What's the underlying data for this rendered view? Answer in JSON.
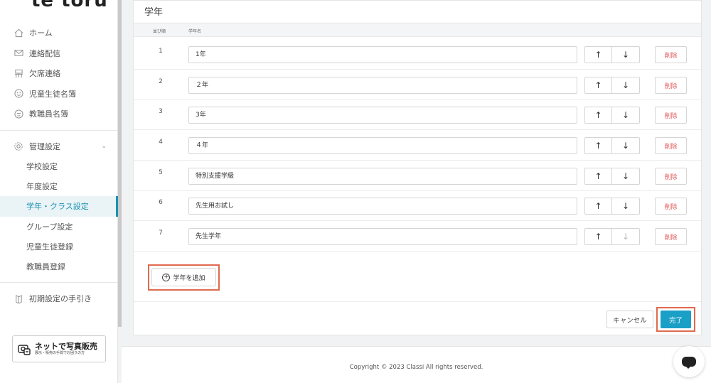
{
  "sidebar": {
    "logo": "te toru",
    "nav": [
      {
        "label": "ホーム",
        "icon": "home-icon"
      },
      {
        "label": "連絡配信",
        "icon": "mail-icon"
      },
      {
        "label": "欠席連絡",
        "icon": "desk-icon"
      },
      {
        "label": "児童生徒名簿",
        "icon": "student-icon"
      },
      {
        "label": "教職員名簿",
        "icon": "teacher-icon"
      }
    ],
    "admin": {
      "label": "管理設定",
      "icon": "gear-icon"
    },
    "sub": [
      {
        "label": "学校設定",
        "active": false
      },
      {
        "label": "年度設定",
        "active": false
      },
      {
        "label": "学年・クラス設定",
        "active": true
      },
      {
        "label": "グループ設定",
        "active": false
      },
      {
        "label": "児童生徒登録",
        "active": false
      },
      {
        "label": "教職員登録",
        "active": false
      }
    ],
    "guide": {
      "label": "初期設定の手引き",
      "icon": "book-icon"
    },
    "banner": {
      "title": "ネットで写真販売",
      "subtitle": "展示・販売の手間でお困りの方"
    }
  },
  "card": {
    "title": "学年",
    "headers": {
      "order": "並び順",
      "name": "学年名"
    },
    "rows": [
      {
        "order": "1",
        "name": "1年",
        "up_disabled": false,
        "down_disabled": false
      },
      {
        "order": "2",
        "name": "２年",
        "up_disabled": false,
        "down_disabled": false
      },
      {
        "order": "3",
        "name": "3年",
        "up_disabled": false,
        "down_disabled": false
      },
      {
        "order": "4",
        "name": "４年",
        "up_disabled": false,
        "down_disabled": false
      },
      {
        "order": "5",
        "name": "特別支援学級",
        "up_disabled": false,
        "down_disabled": false
      },
      {
        "order": "6",
        "name": "先生用お試し",
        "up_disabled": false,
        "down_disabled": false
      },
      {
        "order": "7",
        "name": "先生学年",
        "up_disabled": false,
        "down_disabled": true
      }
    ],
    "up_glyph": "↑",
    "down_glyph": "↓",
    "delete_label": "削除",
    "add_label": "学年を追加",
    "add_glyph": "+",
    "cancel_label": "キャンセル",
    "done_label": "完了"
  },
  "footer": {
    "copyright": "Copyright © 2023 Classi All rights reserved."
  },
  "colors": {
    "accent": "#1a9fc7",
    "danger": "#e05c5c",
    "highlight": "#e06a4f"
  }
}
